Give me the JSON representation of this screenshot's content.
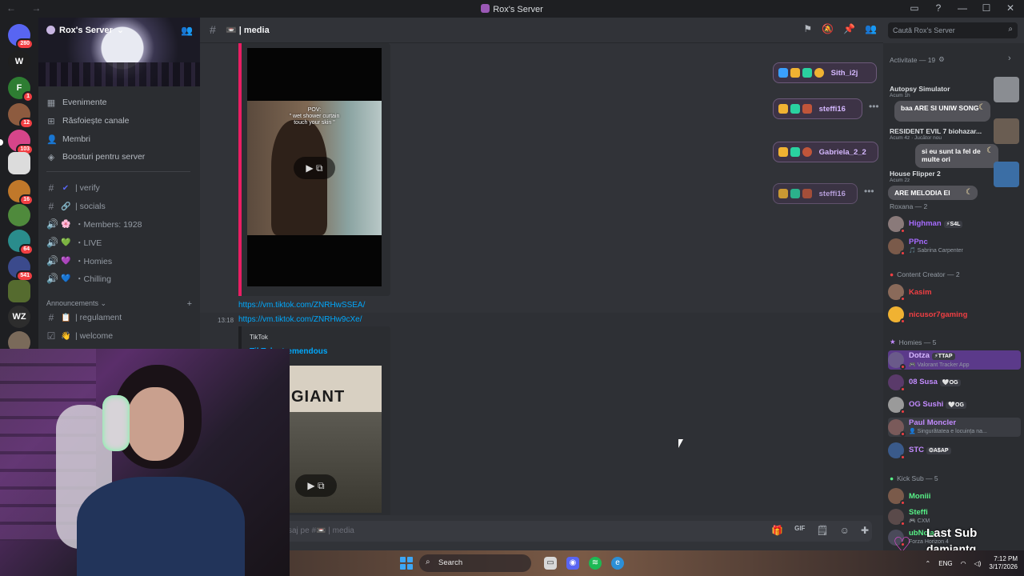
{
  "window": {
    "title": "Rox's Server",
    "nav_label": "← →",
    "controls": [
      "▭",
      "?",
      "—",
      "☐",
      "✕"
    ]
  },
  "rail": {
    "servers": [
      {
        "badge": "280",
        "color": "#5865f2"
      },
      {
        "badge": "",
        "color": "#1f1f1f",
        "glyph": "W"
      },
      {
        "badge": "1",
        "color": "#2e7d32",
        "glyph": "F"
      },
      {
        "badge": "12",
        "color": "#8d5b3f"
      },
      {
        "badge": "103",
        "color": "#d6458a"
      },
      {
        "badge": "",
        "color": "#dcdcdc"
      },
      {
        "badge": "16",
        "color": "#c0782a"
      },
      {
        "badge": "",
        "color": "#4f8a3c"
      },
      {
        "badge": "64",
        "color": "#2a8c8c"
      },
      {
        "badge": "541",
        "color": "#3b4a8c"
      },
      {
        "badge": "",
        "color": "#556b2f"
      },
      {
        "badge": "",
        "color": "#2d2d2d",
        "glyph": "WZ"
      },
      {
        "badge": "",
        "color": "#7a6a5a"
      }
    ]
  },
  "sidebar": {
    "server_name": "Rox's Server",
    "server_chevron": "⌄",
    "menu": [
      {
        "icon": "▦",
        "label": "Evenimente"
      },
      {
        "icon": "⊞",
        "label": "Răsfoiește canale"
      },
      {
        "icon": "👤",
        "label": "Membri"
      },
      {
        "icon": "◈",
        "label": "Boosturi pentru server"
      }
    ],
    "channels": [
      {
        "type": "#",
        "emoji": "✔",
        "label": "| verify"
      },
      {
        "type": "#",
        "emoji": "🔗",
        "label": "| socials"
      },
      {
        "type": "🔊",
        "emoji": "🌸",
        "label": "・Members: 1928"
      },
      {
        "type": "🔊",
        "emoji": "💚",
        "label": "・LIVE"
      },
      {
        "type": "🔊",
        "emoji": "💜",
        "label": "・Homies"
      },
      {
        "type": "🔊",
        "emoji": "💙",
        "label": "・Chilling"
      }
    ],
    "category": "Announcements ⌄",
    "category_add": "+",
    "channels2": [
      {
        "type": "#",
        "emoji": "📋",
        "label": "| regulament"
      },
      {
        "type": "☑",
        "emoji": "👋",
        "label": "| welcome"
      }
    ]
  },
  "chat": {
    "channel_name": "| media",
    "channel_emoji": "📼",
    "header_tools": [
      "⚑",
      "🔕",
      "📌",
      "👥"
    ],
    "search_placeholder": "Caută Rox's Server",
    "video1_caption": "POV:\n\" wet shower curtain\ntouch your skin \"",
    "link1": "https://vm.tiktok.com/ZNRHwSSEA/",
    "timestamp2": "13:18",
    "link2": "https://vm.tiktok.com/ZNRHw9cXe/",
    "embed_provider": "TikTok",
    "embed_title": "TikTok · tremendous",
    "video2_sign": "GIANT",
    "play_glyphs": "▶ ⧉",
    "composer_placeholder": "saj pe #📼 | media",
    "composer_icons": [
      "🎁",
      "GIF",
      "🗒",
      "☺",
      "✚"
    ]
  },
  "alerts": [
    {
      "name": "Sith_i2j"
    },
    {
      "name": "steffi16"
    },
    {
      "name": "Gabriela_2_2"
    },
    {
      "name": "steffi16"
    }
  ],
  "members": {
    "activity_header": "Activitate — 19",
    "activities": [
      {
        "title": "Autopsy Simulator",
        "sub": "Acum 1h"
      },
      {
        "title": "RESIDENT EVIL 7 biohazar...",
        "sub": "Acum 4z · Jucător nou"
      },
      {
        "title": "House Flipper 2",
        "sub": "Acum 2z"
      }
    ],
    "bubbles": [
      {
        "text": "baa ARE SI UNIW SONG"
      },
      {
        "text": "si eu sunt la fel de multe ori"
      },
      {
        "text": "ARE MELODIA EI"
      }
    ],
    "groups": [
      {
        "label": "Roxana — 2",
        "members": [
          {
            "name": "Highman",
            "tag": "⚡S4L",
            "sub": "",
            "color": "#a66bff",
            "av": "#8a7a7a"
          },
          {
            "name": "PPnc",
            "tag": "",
            "sub": "🎵 Sabrina Carpenter",
            "color": "#a66bff",
            "av": "#7a5a4a"
          }
        ]
      },
      {
        "label": "Content Creator — 2",
        "members": [
          {
            "name": "Kasim",
            "tag": "",
            "sub": "",
            "color": "#f23f43",
            "av": "#8a6a5a"
          },
          {
            "name": "nicusor7gaming",
            "tag": "",
            "sub": "",
            "color": "#f23f43",
            "av": "#f0b232"
          }
        ]
      },
      {
        "label": "Homies — 5",
        "members": [
          {
            "name": "Dotza",
            "tag": "⚡TTAP",
            "sub": "🎮 Valorant Tracker App",
            "color": "#c38bff",
            "av": "#6a5a8a"
          },
          {
            "name": "08 Susa",
            "tag": "🤍OG",
            "sub": "",
            "color": "#c38bff",
            "av": "#5a3a6a"
          },
          {
            "name": "OG Sushi",
            "tag": "🤍OG",
            "sub": "",
            "color": "#c38bff",
            "av": "#9a9a9a"
          },
          {
            "name": "Paul Moncler",
            "tag": "",
            "sub": "👤 Singurătatea e locuința na...",
            "color": "#c38bff",
            "av": "#7a5a5a"
          },
          {
            "name": "STC",
            "tag": "❂A$AP",
            "sub": "",
            "color": "#c38bff",
            "av": "#3a5a8a"
          }
        ]
      },
      {
        "label": "Kick Sub — 5",
        "members": [
          {
            "name": "Moniii",
            "tag": "",
            "sub": "",
            "color": "#57f287",
            "av": "#7a5a4a"
          },
          {
            "name": "Steffi",
            "tag": "",
            "sub": "🎮 CXM",
            "color": "#57f287",
            "av": "#5a4a4a"
          },
          {
            "name": "ubNcia",
            "tag": "",
            "sub": "Forza Horizon 4",
            "color": "#57f287",
            "av": "#4a4a5a"
          }
        ]
      }
    ]
  },
  "overlay": {
    "last_sub_label": "Last Sub",
    "last_sub_name": "damiantg"
  },
  "taskbar": {
    "search_label": "Search",
    "tray_lang": "ENG",
    "time": "7:12 PM",
    "date": "3/17/2026"
  }
}
